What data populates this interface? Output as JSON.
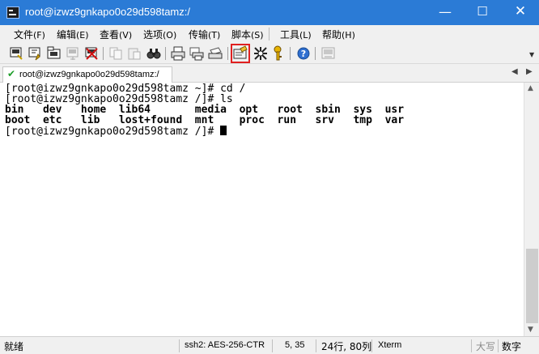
{
  "window": {
    "title": "root@izwz9gnkapo0o29d598tamz:/",
    "minimize": "—",
    "maximize": "☐",
    "close": "✕"
  },
  "menu": {
    "items": [
      {
        "label": "文件",
        "accel": "(F)"
      },
      {
        "label": "编辑",
        "accel": "(E)"
      },
      {
        "label": "查看",
        "accel": "(V)"
      },
      {
        "label": "选项",
        "accel": "(O)"
      },
      {
        "label": "传输",
        "accel": "(T)"
      },
      {
        "label": "脚本",
        "accel": "(S)"
      },
      {
        "label": "工具",
        "accel": "(L)"
      },
      {
        "label": "帮助",
        "accel": "(H)"
      }
    ]
  },
  "toolbar": {
    "buttons": [
      "connect-icon",
      "quick-connect-icon",
      "connect-in-tab-icon",
      "reconnect-icon",
      "disconnect-icon",
      "copy-icon",
      "paste-icon",
      "find-icon",
      "print-icon",
      "print-setup-icon",
      "print-screen-icon",
      "session-options-icon",
      "global-options-icon",
      "keymap-icon",
      "help-icon",
      "sftp-icon"
    ],
    "highlighted": "session-options-icon",
    "highlight_color": "#e02020"
  },
  "tabs": {
    "active": {
      "label": "root@izwz9gnkapo0o29d598tamz:/",
      "status_icon": "check-icon",
      "status_color": "#1e9e2a"
    },
    "prev_glyph": "◀",
    "next_glyph": "▶"
  },
  "terminal": {
    "lines": [
      "[root@izwz9gnkapo0o29d598tamz ~]# cd /",
      "[root@izwz9gnkapo0o29d598tamz /]# ls",
      "bin   dev   home  lib64       media  opt   root  sbin  sys  usr",
      "boot  etc   lib   lost+found  mnt    proc  run   srv   tmp  var",
      "[root@izwz9gnkapo0o29d598tamz /]# "
    ]
  },
  "status": {
    "ready": "就绪",
    "cipher": "ssh2: AES-256-CTR",
    "cursor_pos": "5, 35",
    "size": "24行, 80列",
    "term_type": "Xterm",
    "caps": "大写",
    "num": "数字"
  }
}
